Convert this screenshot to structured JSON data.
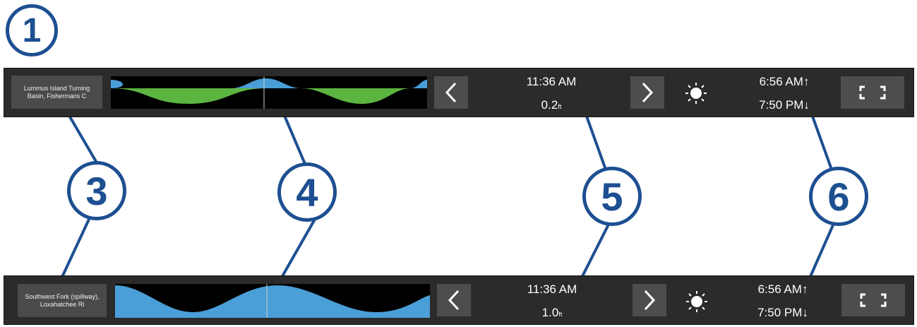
{
  "callouts": [
    "1",
    "3",
    "4",
    "5",
    "6"
  ],
  "top_bar": {
    "station": "Lummus Island Turning Basin, Fishermans C",
    "time": "11:36 AM",
    "value": "0.2",
    "value_suffix": "ft",
    "sunrise": "6:56 AM",
    "sunrise_arrow": "↑",
    "sunset": "7:50 PM",
    "sunset_arrow": "↓"
  },
  "bottom_bar": {
    "station": "Southwest Fork (spillway), Loxahatchee Ri",
    "time": "11:36 AM",
    "value": "1.0",
    "value_suffix": "ft",
    "sunrise": "6:56 AM",
    "sunrise_arrow": "↑",
    "sunset": "7:50 PM",
    "sunset_arrow": "↓"
  },
  "icons": {
    "prev": "chevron-left-icon",
    "next": "chevron-right-icon",
    "sun": "sun-icon",
    "fullscreen": "fullscreen-icon"
  },
  "colors": {
    "callout": "#1d4f91",
    "flood": "#4a9fd8",
    "ebb": "#5cb541",
    "bar": "#2b2b2b",
    "button": "#4d4d4d"
  }
}
